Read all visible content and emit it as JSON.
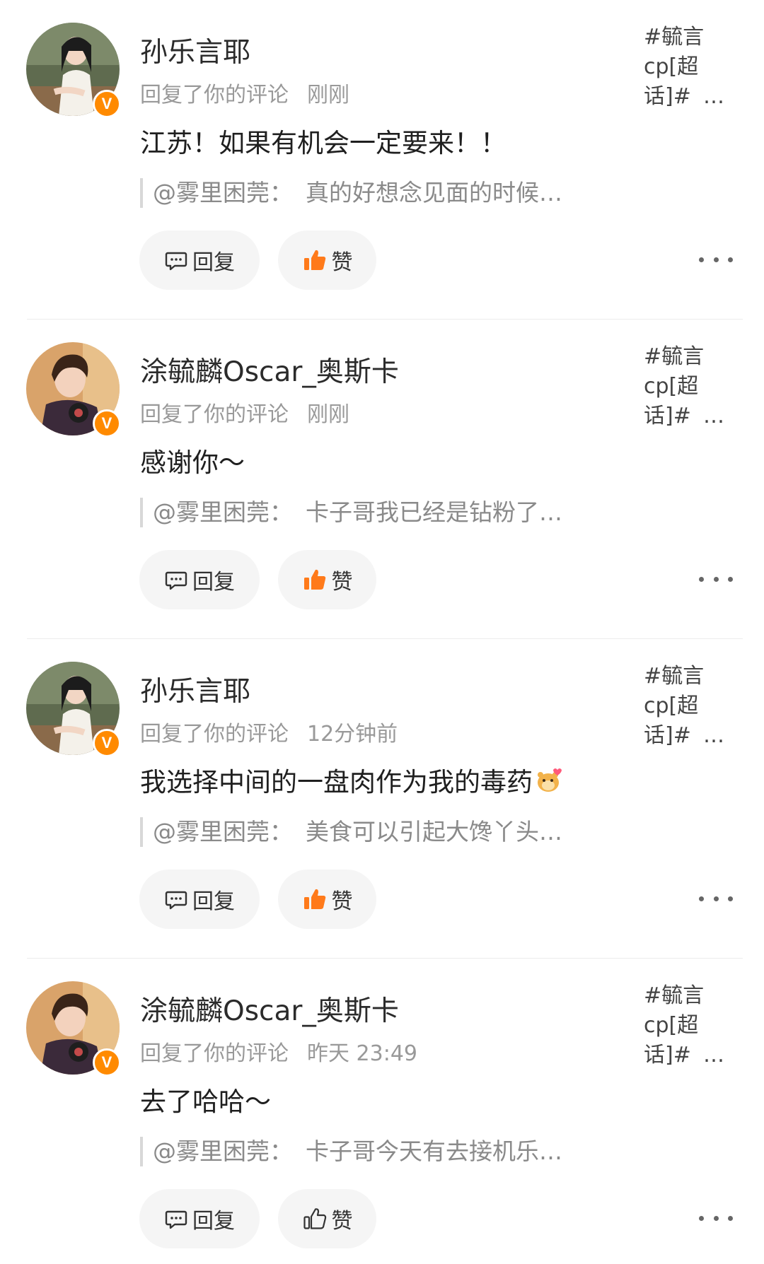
{
  "comments": [
    {
      "name": "孙乐言耶",
      "action": "回复了你的评论",
      "time": "刚刚",
      "content": "江苏！如果有机会一定要来！！",
      "quote_user": "@雾里困莞：",
      "quote_text": "真的好想念见面的时候…",
      "topic": "#毓言cp[超话]#",
      "topic_more": "…",
      "reply_label": "回复",
      "like_label": "赞",
      "liked": true,
      "avatar": "female-avatar",
      "has_emoji": false
    },
    {
      "name": "涂毓麟Oscar_奥斯卡",
      "action": "回复了你的评论",
      "time": "刚刚",
      "content": "感谢你～",
      "quote_user": "@雾里困莞：",
      "quote_text": "卡子哥我已经是钻粉了…",
      "topic": "#毓言cp[超话]#",
      "topic_more": "…",
      "reply_label": "回复",
      "like_label": "赞",
      "liked": true,
      "avatar": "male-avatar",
      "has_emoji": false
    },
    {
      "name": "孙乐言耶",
      "action": "回复了你的评论",
      "time": "12分钟前",
      "content": "我选择中间的一盘肉作为我的毒药",
      "quote_user": "@雾里困莞：",
      "quote_text": "美食可以引起大馋丫头…",
      "topic": "#毓言cp[超话]#",
      "topic_more": "…",
      "reply_label": "回复",
      "like_label": "赞",
      "liked": true,
      "avatar": "female-avatar",
      "has_emoji": true,
      "emoji": "hamster-love-icon"
    },
    {
      "name": "涂毓麟Oscar_奥斯卡",
      "action": "回复了你的评论",
      "time": "昨天 23:49",
      "content": "去了哈哈～",
      "quote_user": "@雾里困莞：",
      "quote_text": "卡子哥今天有去接机乐…",
      "topic": "#毓言cp[超话]#",
      "topic_more": "…",
      "reply_label": "回复",
      "like_label": "赞",
      "liked": false,
      "avatar": "male-avatar",
      "has_emoji": false
    }
  ],
  "verified_badge": "V",
  "colors": {
    "liked": "#ff7a1a",
    "verified": "#ff8a00",
    "button_bg": "#f5f5f5"
  }
}
